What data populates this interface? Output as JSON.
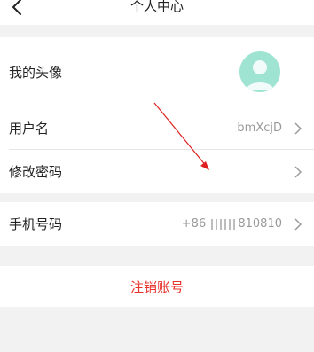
{
  "header": {
    "title": "个人中心",
    "back_icon": "chevron-left-icon"
  },
  "profile": {
    "avatar_label": "我的头像",
    "username_label": "用户名",
    "username_value": "bmXcjD",
    "password_label": "修改密码"
  },
  "contact": {
    "phone_label": "手机号码",
    "phone_prefix": "+86",
    "phone_suffix": "810810"
  },
  "account": {
    "logout_label": "注销账号"
  },
  "colors": {
    "accent_red": "#e8322c",
    "avatar_bg": "#9fe3d3",
    "page_bg": "#f2f2f2"
  }
}
